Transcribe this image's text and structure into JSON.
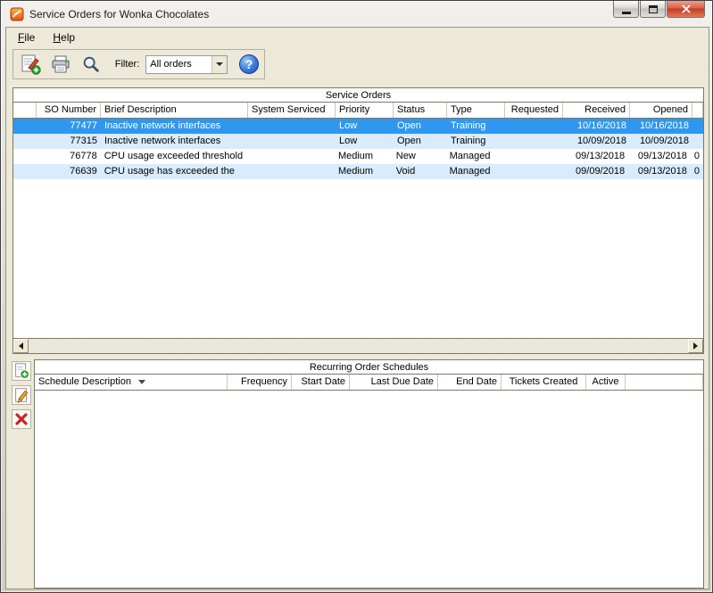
{
  "window": {
    "title": "Service Orders for Wonka Chocolates"
  },
  "menu": {
    "file": "File",
    "help": "Help"
  },
  "toolbar": {
    "filter_label": "Filter:",
    "filter_value": "All orders"
  },
  "icons": {
    "help_glyph": "?"
  },
  "service_orders": {
    "title": "Service Orders",
    "columns": [
      "",
      "SO Number",
      "Brief Description",
      "System Serviced",
      "Priority",
      "Status",
      "Type",
      "Requested",
      "Received",
      "Opened",
      ""
    ],
    "rows": [
      {
        "selected": true,
        "cells": [
          "",
          "77477",
          "Inactive network interfaces",
          "",
          "Low",
          "Open",
          "Training",
          "",
          "10/16/2018",
          "10/16/2018",
          ""
        ]
      },
      {
        "selected": false,
        "cells": [
          "",
          "77315",
          "Inactive network interfaces",
          "",
          "Low",
          "Open",
          "Training",
          "",
          "10/09/2018",
          "10/09/2018",
          ""
        ]
      },
      {
        "selected": false,
        "cells": [
          "",
          "76778",
          "CPU usage exceeded threshold",
          "",
          "Medium",
          "New",
          "Managed",
          "",
          "09/13/2018",
          "09/13/2018",
          "0"
        ]
      },
      {
        "selected": false,
        "cells": [
          "",
          "76639",
          "CPU usage has exceeded the",
          "",
          "Medium",
          "Void",
          "Managed",
          "",
          "09/09/2018",
          "09/13/2018",
          "0"
        ]
      }
    ]
  },
  "recurring": {
    "title": "Recurring Order Schedules",
    "columns": [
      "Schedule Description",
      "Frequency",
      "Start Date",
      "Last Due Date",
      "End Date",
      "Tickets Created",
      "Active",
      ""
    ],
    "sort": {
      "column": "Schedule Description",
      "direction": "desc"
    },
    "rows": []
  }
}
